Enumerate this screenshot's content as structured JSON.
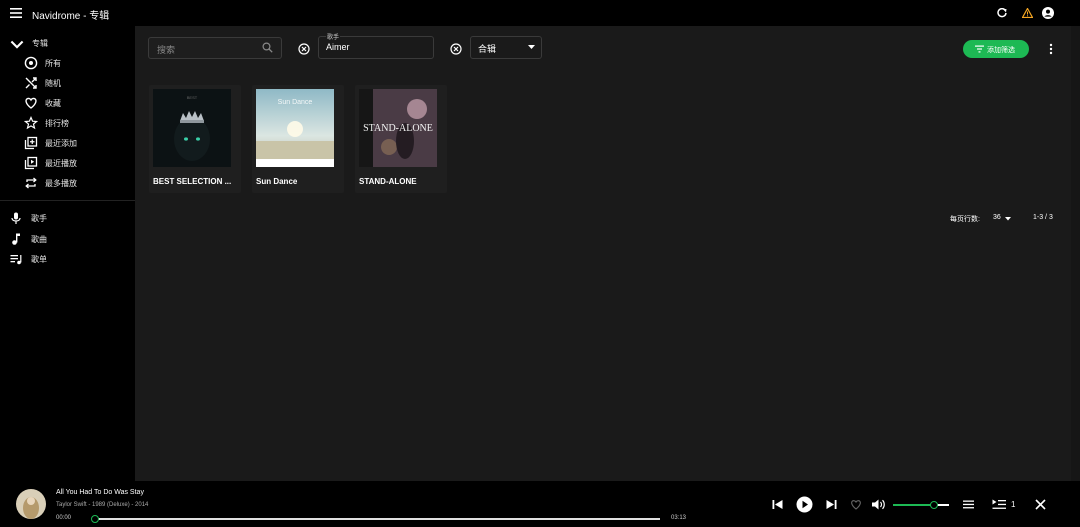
{
  "app": {
    "title": "Navidrome - 专辑"
  },
  "sidebar": {
    "section_label": "专辑",
    "album_items": [
      {
        "label": "所有",
        "icon": "album-all-icon"
      },
      {
        "label": "随机",
        "icon": "shuffle-icon"
      },
      {
        "label": "收藏",
        "icon": "heart-icon"
      },
      {
        "label": "排行榜",
        "icon": "star-icon"
      },
      {
        "label": "最近添加",
        "icon": "library-add-icon"
      },
      {
        "label": "最近播放",
        "icon": "video-library-icon"
      },
      {
        "label": "最多播放",
        "icon": "repeat-icon"
      }
    ],
    "main_items": [
      {
        "label": "歌手",
        "icon": "mic-icon"
      },
      {
        "label": "歌曲",
        "icon": "music-note-icon"
      },
      {
        "label": "歌单",
        "icon": "playlist-icon"
      }
    ]
  },
  "filters": {
    "search_placeholder": "搜索",
    "artist_label": "歌手",
    "artist_value": "Aimer",
    "type_value": "合辑",
    "add_filter_label": "添加筛选"
  },
  "albums": [
    {
      "name": "BEST SELECTION ...",
      "cover_text": "BEST"
    },
    {
      "name": "Sun Dance",
      "cover_text": "Sun Dance"
    },
    {
      "name": "STAND-ALONE",
      "cover_text": "STAND-ALONE"
    }
  ],
  "pagination": {
    "rows_label": "每页行数:",
    "rows_value": "36",
    "range": "1-3 / 3"
  },
  "player": {
    "title": "All You Had To Do Was Stay",
    "subtitle": "Taylor Swift - 1989 (Deluxe) - 2014",
    "current_time": "00:00",
    "duration": "03:13",
    "progress": 0.0,
    "volume": 0.72,
    "queue_count": "1"
  },
  "colors": {
    "accent": "#1db954",
    "warning": "#f5a623",
    "background": "#1a1a1a"
  }
}
